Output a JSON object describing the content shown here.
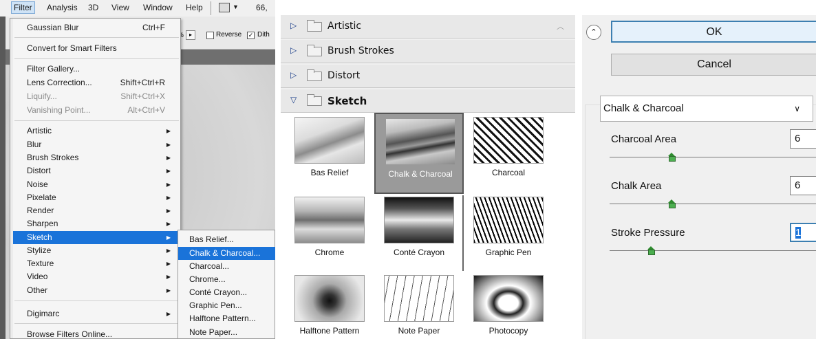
{
  "menubar": {
    "items": [
      "Filter",
      "Analysis",
      "3D",
      "View",
      "Window",
      "Help"
    ],
    "zoom": "66,"
  },
  "optionsbar": {
    "reverse_label": "Reverse",
    "dither_label": "Dith"
  },
  "filter_menu": {
    "items": [
      {
        "label": "Gaussian Blur",
        "shortcut": "Ctrl+F"
      },
      {
        "label": "Convert for Smart Filters"
      },
      {
        "label": "Filter Gallery..."
      },
      {
        "label": "Lens Correction...",
        "shortcut": "Shift+Ctrl+R"
      },
      {
        "label": "Liquify...",
        "shortcut": "Shift+Ctrl+X",
        "disabled": true
      },
      {
        "label": "Vanishing Point...",
        "shortcut": "Alt+Ctrl+V",
        "disabled": true
      },
      {
        "label": "Artistic"
      },
      {
        "label": "Blur"
      },
      {
        "label": "Brush Strokes"
      },
      {
        "label": "Distort"
      },
      {
        "label": "Noise"
      },
      {
        "label": "Pixelate"
      },
      {
        "label": "Render"
      },
      {
        "label": "Sharpen"
      },
      {
        "label": "Sketch",
        "selected": true
      },
      {
        "label": "Stylize"
      },
      {
        "label": "Texture"
      },
      {
        "label": "Video"
      },
      {
        "label": "Other"
      },
      {
        "label": "Digimarc"
      },
      {
        "label": "Browse Filters Online..."
      }
    ]
  },
  "sketch_submenu": {
    "items": [
      "Bas Relief...",
      "Chalk & Charcoal...",
      "Charcoal...",
      "Chrome...",
      "Conté Crayon...",
      "Graphic Pen...",
      "Halftone Pattern...",
      "Note Paper..."
    ],
    "selected": "Chalk & Charcoal..."
  },
  "gallery": {
    "folders": [
      "Artistic",
      "Brush Strokes",
      "Distort",
      "Sketch"
    ],
    "open_folder": "Sketch",
    "thumbnails": [
      "Bas Relief",
      "Chalk & Charcoal",
      "Charcoal",
      "Chrome",
      "Conté Crayon",
      "Graphic Pen",
      "Halftone Pattern",
      "Note Paper",
      "Photocopy"
    ],
    "selected": "Chalk & Charcoal"
  },
  "settings": {
    "ok_label": "OK",
    "cancel_label": "Cancel",
    "filter_select": "Chalk & Charcoal",
    "params": [
      {
        "label": "Charcoal Area",
        "value": "6",
        "slider_fraction": 0.3
      },
      {
        "label": "Chalk Area",
        "value": "6",
        "slider_fraction": 0.3
      },
      {
        "label": "Stroke Pressure",
        "value": "1",
        "slider_fraction": 0.2
      }
    ]
  },
  "colors": {
    "menu_highlight": "#1a73d9",
    "ok_border": "#3c7fb1",
    "slider_thumb": "#4caf50"
  }
}
